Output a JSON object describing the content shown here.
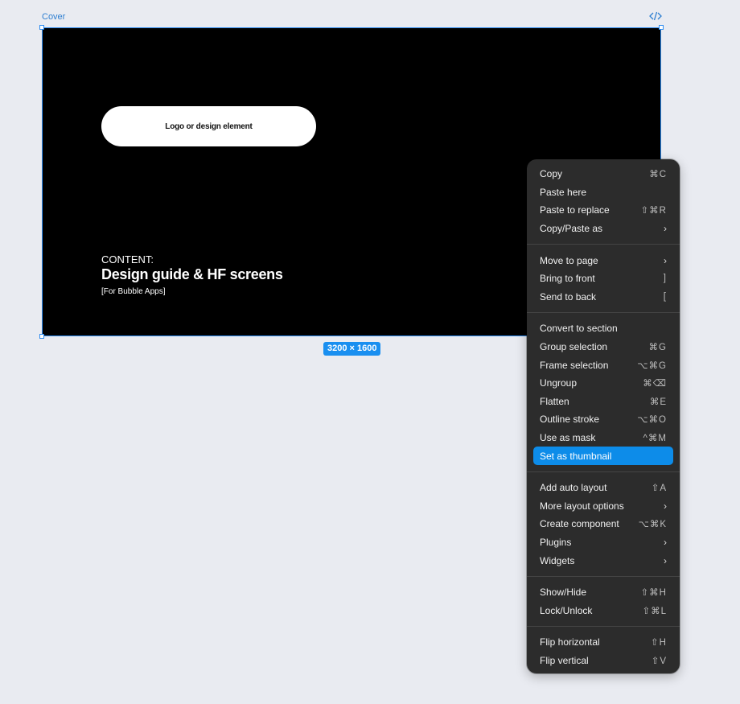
{
  "frame": {
    "label": "Cover",
    "logo_text": "Logo or design element",
    "content_label": "CONTENT:",
    "content_title": "Design guide & HF screens",
    "content_sub": "[For Bubble Apps]",
    "size_badge": "3200 × 1600"
  },
  "colors": {
    "selection": "#2f8cf0",
    "menu_bg": "#2c2c2c",
    "menu_highlight": "#0d8ce9",
    "canvas_bg": "#e9ebf1"
  },
  "menu": {
    "groups": [
      [
        {
          "label": "Copy",
          "shortcut": "⌘C"
        },
        {
          "label": "Paste here",
          "shortcut": ""
        },
        {
          "label": "Paste to replace",
          "shortcut": "⇧⌘R"
        },
        {
          "label": "Copy/Paste as",
          "shortcut": "›"
        }
      ],
      [
        {
          "label": "Move to page",
          "shortcut": "›"
        },
        {
          "label": "Bring to front",
          "shortcut": "]"
        },
        {
          "label": "Send to back",
          "shortcut": "["
        }
      ],
      [
        {
          "label": "Convert to section",
          "shortcut": ""
        },
        {
          "label": "Group selection",
          "shortcut": "⌘G"
        },
        {
          "label": "Frame selection",
          "shortcut": "⌥⌘G"
        },
        {
          "label": "Ungroup",
          "shortcut": "⌘⌫"
        },
        {
          "label": "Flatten",
          "shortcut": "⌘E"
        },
        {
          "label": "Outline stroke",
          "shortcut": "⌥⌘O"
        },
        {
          "label": "Use as mask",
          "shortcut": "^⌘M"
        },
        {
          "label": "Set as thumbnail",
          "shortcut": ""
        }
      ],
      [
        {
          "label": "Add auto layout",
          "shortcut": "⇧A"
        },
        {
          "label": "More layout options",
          "shortcut": "›"
        },
        {
          "label": "Create component",
          "shortcut": "⌥⌘K"
        },
        {
          "label": "Plugins",
          "shortcut": "›"
        },
        {
          "label": "Widgets",
          "shortcut": "›"
        }
      ],
      [
        {
          "label": "Show/Hide",
          "shortcut": "⇧⌘H"
        },
        {
          "label": "Lock/Unlock",
          "shortcut": "⇧⌘L"
        }
      ],
      [
        {
          "label": "Flip horizontal",
          "shortcut": "⇧H"
        },
        {
          "label": "Flip vertical",
          "shortcut": "⇧V"
        }
      ]
    ]
  }
}
